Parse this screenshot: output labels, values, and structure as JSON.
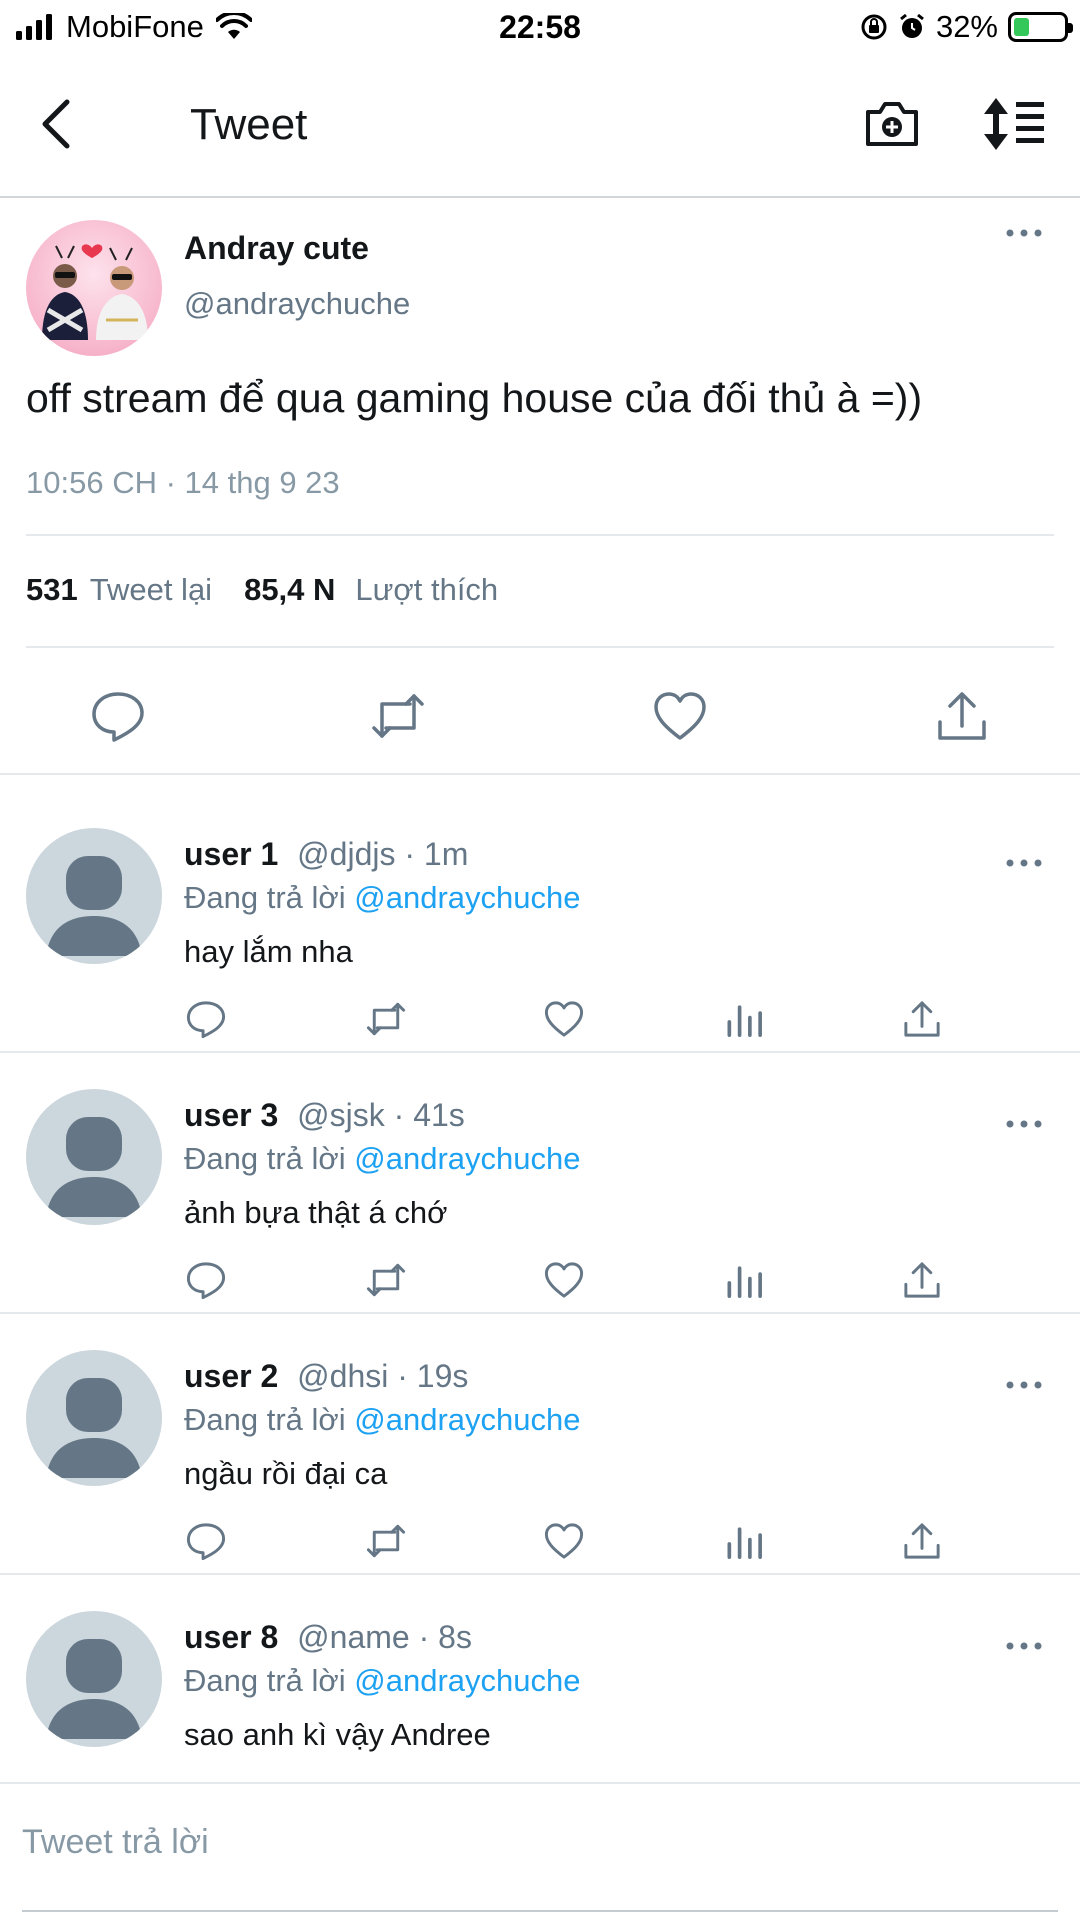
{
  "status_bar": {
    "carrier": "MobiFone",
    "time": "22:58",
    "battery": "32%",
    "battery_level": 0.32,
    "icons": [
      "signal-icon",
      "wifi-icon",
      "orientation-lock-icon",
      "alarm-icon",
      "battery-charging-icon"
    ]
  },
  "nav": {
    "title": "Tweet",
    "icons": [
      "back-icon",
      "camera-icon",
      "sort-icon"
    ]
  },
  "main_tweet": {
    "name": "Andray cute",
    "handle": "@andraychuche",
    "text": "off stream để qua gaming house của đối thủ à =))",
    "timestamp": "10:56 CH · 14 thg 9 23",
    "retweets_count": "531",
    "retweets_label": "Tweet lại",
    "likes_count": "85,4 N",
    "likes_label": "Lượt thích",
    "actions": [
      "reply-icon",
      "retweet-icon",
      "like-icon",
      "share-icon"
    ]
  },
  "replies": [
    {
      "name": "user 1",
      "handle": "@djdjs · 1m",
      "replying_label": "Đang trả lời",
      "replying_to": "@andraychuche",
      "text": "hay lắm nha"
    },
    {
      "name": "user 3",
      "handle": "@sjsk · 41s",
      "replying_label": "Đang trả lời",
      "replying_to": "@andraychuche",
      "text": "ảnh bựa thật á chớ"
    },
    {
      "name": "user 2",
      "handle": "@dhsi · 19s",
      "replying_label": "Đang trả lời",
      "replying_to": "@andraychuche",
      "text": "ngầu rồi đại ca"
    },
    {
      "name": "user 8",
      "handle": "@name · 8s",
      "replying_label": "Đang trả lời",
      "replying_to": "@andraychuche",
      "text": "sao anh kì vậy Andree"
    }
  ],
  "compose": {
    "placeholder": "Tweet trả lời"
  },
  "colors": {
    "accent": "#1da1f2",
    "muted": "#657786",
    "text": "#14171a",
    "divider": "#e6e9ec",
    "battery_fill": "#34c759",
    "avatar_placeholder": "#ccd6dd"
  }
}
